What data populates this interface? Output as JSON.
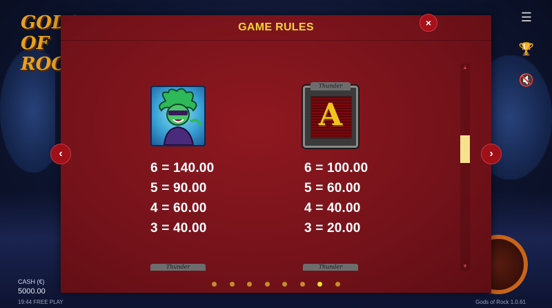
{
  "background": {
    "logo_text": "GODS OF ROCK",
    "cash_label": "CASH (€)",
    "cash_value": "5000.00",
    "time_info": "19:44 FREE PLAY",
    "version": "Gods of Rock 1.0.61"
  },
  "dialog": {
    "title": "GAME RULES",
    "close_label": "×",
    "prev_label": "‹",
    "next_label": "›"
  },
  "symbols": [
    {
      "name": "medusa",
      "payouts": [
        "6 = 140.00",
        "5 = 90.00",
        "4 = 60.00",
        "3 = 40.00"
      ]
    },
    {
      "name": "a",
      "badge": "Thunder",
      "letter": "A",
      "payouts": [
        "6 = 100.00",
        "5 = 60.00",
        "4 = 40.00",
        "3 = 20.00"
      ]
    }
  ],
  "next_row_badges": [
    "Thunder",
    "Thunder"
  ],
  "pagination": {
    "pages": 8,
    "active": 7
  },
  "colors": {
    "panel": "#74121a",
    "title": "#f4d23c",
    "dot": "#c78d2a",
    "dot_active": "#f6e22a",
    "scroll_thumb": "#f6e28c"
  },
  "icons": [
    "menu-icon",
    "trophy-icon",
    "sound-off-icon",
    "close-icon",
    "chevron-left-icon",
    "chevron-right-icon"
  ]
}
